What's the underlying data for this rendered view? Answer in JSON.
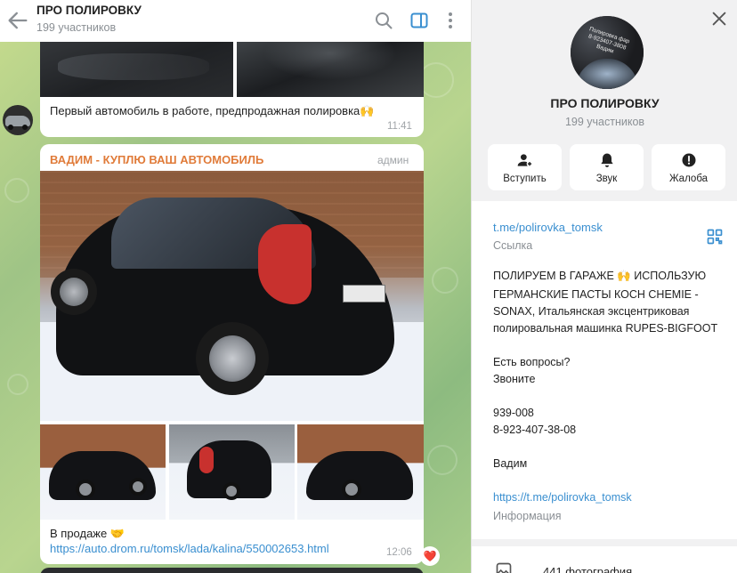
{
  "header": {
    "title": "ПРО ПОЛИРОВКУ",
    "subtitle": "199 участников"
  },
  "messages": {
    "first_caption": "Первый автомобиль в работе, предпродажная полировка🙌",
    "first_time": "11:41",
    "sender_name": "ВАДИМ - КУПЛЮ ВАШ АВТОМОБИЛЬ",
    "sender_badge": "админ",
    "sale_caption": "В продаже 🤝",
    "sale_link": "https://auto.drom.ru/tomsk/lada/kalina/550002653.html",
    "sale_time": "12:06",
    "reaction": "❤️"
  },
  "panel": {
    "name": "ПРО ПОЛИРОВКУ",
    "members": "199 участников",
    "actions": [
      "Вступить",
      "Звук",
      "Жалоба"
    ],
    "link": "t.me/polirovka_tomsk",
    "link_caption": "Ссылка",
    "description_lines": [
      "ПОЛИРУЕМ В ГАРАЖЕ 🙌 ИСПОЛЬЗУЮ",
      "ГЕРМАНСКИЕ ПАСТЫ КОСН СНЕМIE -",
      "SONAX,  Итальянская  эксцентриковая",
      "полировальная машинка RUPES-BIGFOOT",
      "",
      "Есть вопросы?",
      "Звоните",
      "",
      "939-008",
      "8-923-407-38-08",
      "",
      "Вадим",
      "",
      "https://t.me/polirovka_tomsk"
    ],
    "info_caption": "Информация",
    "photos_count": "441 фотография",
    "avatar_text": [
      "Полировка фар",
      "8-923407-3808",
      "Вадим"
    ]
  },
  "colors": {
    "accent": "#3a8fd0",
    "sender": "#e07b39",
    "chat_bg": "#a9cd8b",
    "panel_bg": "#f1f1f2"
  },
  "icons": [
    "back-icon",
    "search-icon",
    "sidebar-toggle-icon",
    "more-icon",
    "close-icon",
    "add-user-icon",
    "bell-icon",
    "report-icon",
    "qr-code-icon",
    "photos-icon"
  ]
}
